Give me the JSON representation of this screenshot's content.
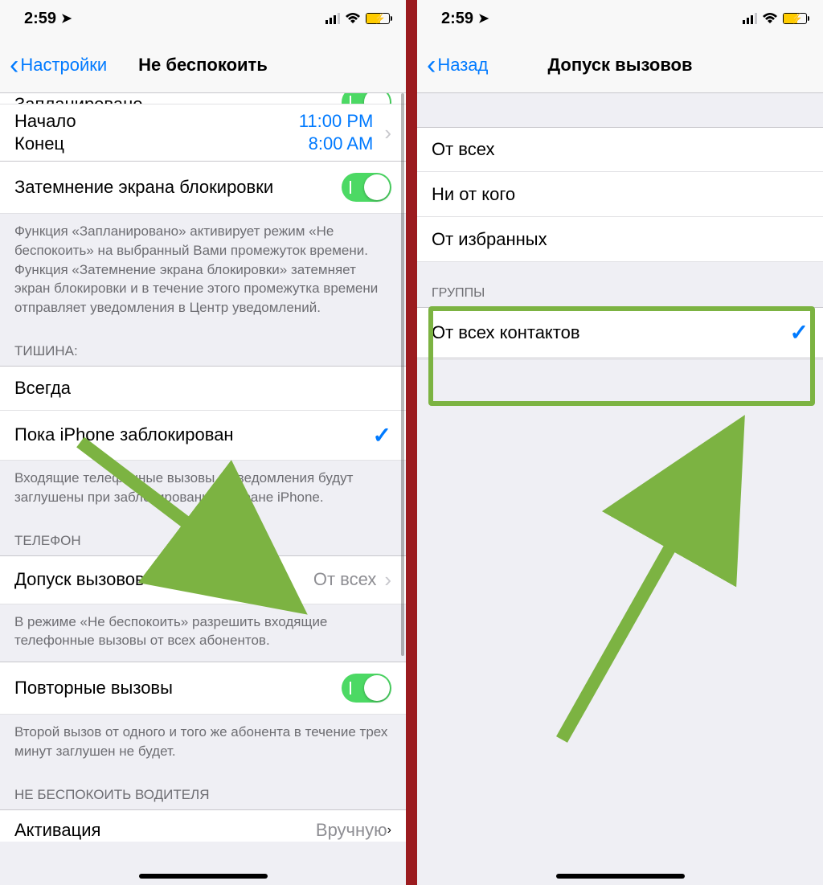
{
  "status": {
    "time": "2:59"
  },
  "left": {
    "nav_back": "Настройки",
    "nav_title": "Не беспокоить",
    "partial_top": "Запланировано",
    "schedule": {
      "start_label": "Начало",
      "start_value": "11:00 PM",
      "end_label": "Конец",
      "end_value": "8:00 AM"
    },
    "dim_lock": "Затемнение экрана блокировки",
    "footer1": "Функция «Запланировано» активирует режим «Не беспокоить» на выбранный Вами промежуток времени. Функция «Затемнение экрана блокировки» затемняет экран блокировки и в течение этого промежутка времени отправляет уведомления в Центр уведомлений.",
    "silence_header": "ТИШИНА:",
    "always": "Всегда",
    "while_locked": "Пока iPhone заблокирован",
    "footer2": "Входящие телефонные вызовы и уведомления будут заглушены при заблокированном экране iPhone.",
    "phone_header": "ТЕЛЕФОН",
    "allow_calls": "Допуск вызовов",
    "allow_calls_value": "От всех",
    "footer3": "В режиме «Не беспокоить» разрешить входящие телефонные вызовы от всех абонентов.",
    "repeated": "Повторные вызовы",
    "footer4": "Второй вызов от одного и того же абонента в течение трех минут заглушен не будет.",
    "driver_header": "НЕ БЕСПОКОИТЬ ВОДИТЕЛЯ",
    "activation": "Активация",
    "activation_value": "Вручную"
  },
  "right": {
    "nav_back": "Назад",
    "nav_title": "Допуск вызовов",
    "opt1": "От всех",
    "opt2": "Ни от кого",
    "opt3": "От избранных",
    "groups_header": "ГРУППЫ",
    "all_contacts": "От всех контактов"
  }
}
